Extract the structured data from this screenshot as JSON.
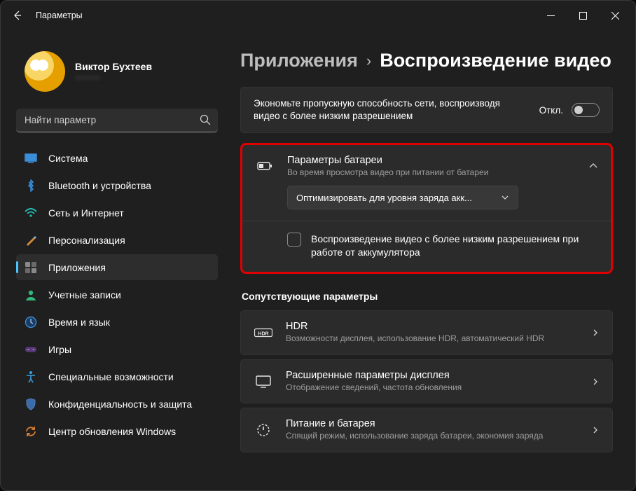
{
  "titlebar": {
    "title": "Параметры"
  },
  "profile": {
    "name": "Виктор Бухтеев",
    "email": "———"
  },
  "search": {
    "placeholder": "Найти параметр"
  },
  "nav": [
    {
      "label": "Система"
    },
    {
      "label": "Bluetooth и устройства"
    },
    {
      "label": "Сеть и Интернет"
    },
    {
      "label": "Персонализация"
    },
    {
      "label": "Приложения"
    },
    {
      "label": "Учетные записи"
    },
    {
      "label": "Время и язык"
    },
    {
      "label": "Игры"
    },
    {
      "label": "Специальные возможности"
    },
    {
      "label": "Конфиденциальность и защита"
    },
    {
      "label": "Центр обновления Windows"
    }
  ],
  "breadcrumb": {
    "parent": "Приложения",
    "current": "Воспроизведение видео"
  },
  "bandwidth": {
    "desc": "Экономьте пропускную способность сети, воспроизводя видео с более низким разрешением",
    "state": "Откл."
  },
  "battery": {
    "title": "Параметры батареи",
    "sub": "Во время просмотра видео при питании от батареи",
    "dropdown": "Оптимизировать для уровня заряда акк...",
    "checkbox_label": "Воспроизведение видео с более низким разрешением при работе от аккумулятора"
  },
  "related": {
    "heading": "Сопутствующие параметры",
    "items": [
      {
        "title": "HDR",
        "sub": "Возможности дисплея, использование HDR, автоматический HDR"
      },
      {
        "title": "Расширенные параметры дисплея",
        "sub": "Отображение сведений, частота обновления"
      },
      {
        "title": "Питание и батарея",
        "sub": "Спящий режим, использование заряда батареи, экономия заряда"
      }
    ]
  }
}
